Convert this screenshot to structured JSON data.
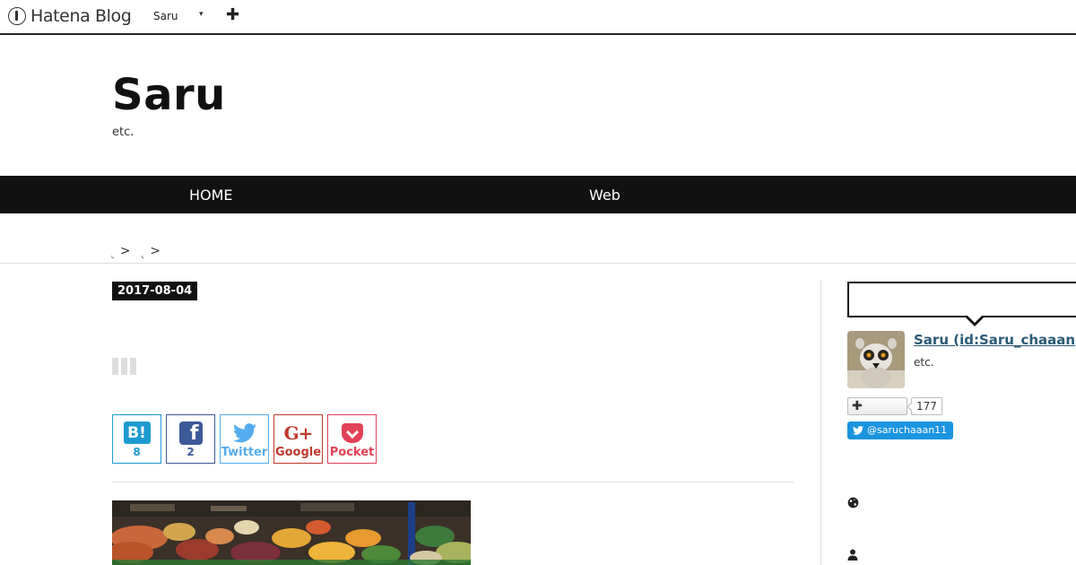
{
  "header": {
    "logo_text": "Hatena Blog",
    "user_name": "Saru",
    "caret": "▾",
    "plus": "✚"
  },
  "blog": {
    "title": "Saru",
    "description": "etc."
  },
  "nav": {
    "items": [
      "HOME",
      "Web"
    ]
  },
  "breadcrumb": {
    "separators": [
      ">",
      ">"
    ]
  },
  "article": {
    "date": "2017-08-04",
    "share_buttons": [
      {
        "service": "hatena",
        "icon": "B!",
        "count": "8"
      },
      {
        "service": "facebook",
        "icon": "f",
        "count": "2"
      },
      {
        "service": "twitter",
        "label": "Twitter"
      },
      {
        "service": "google",
        "icon": "G+",
        "label": "Google"
      },
      {
        "service": "pocket",
        "label": "Pocket"
      }
    ]
  },
  "sidebar": {
    "profile_name": "Saru (id:Saru_chaaan",
    "profile_desc": "etc.",
    "follow_plus": "✚",
    "follow_count": "177",
    "twitter_handle": "@saruchaaan11"
  },
  "colors": {
    "hatena": "#1d9bd1",
    "facebook": "#3b5998",
    "twitter": "#55acee",
    "google": "#c0392b",
    "pocket": "#e24057",
    "twitter_follow": "#1b95e0",
    "navbar": "#111111"
  }
}
